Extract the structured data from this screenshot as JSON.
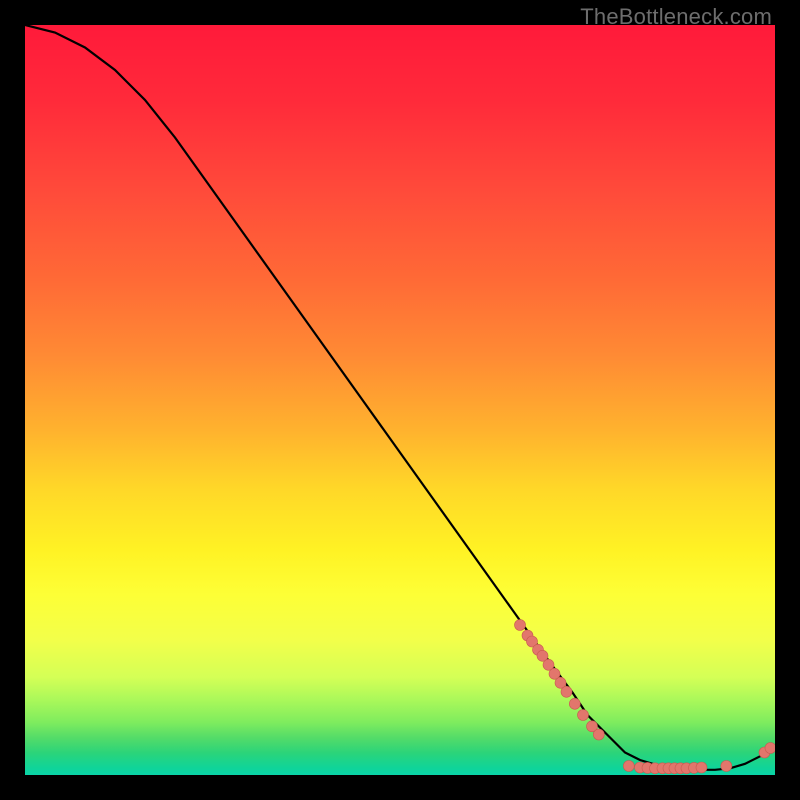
{
  "watermark": "TheBottleneck.com",
  "colors": {
    "curve_stroke": "#000000",
    "dot_fill": "#e2766c",
    "dot_stroke": "#c95a50"
  },
  "chart_data": {
    "type": "line",
    "title": "",
    "xlabel": "",
    "ylabel": "",
    "xlim": [
      0,
      100
    ],
    "ylim": [
      0,
      100
    ],
    "grid": false,
    "legend": false,
    "series": [
      {
        "name": "curve",
        "x": [
          0,
          4,
          8,
          12,
          16,
          20,
          25,
          30,
          35,
          40,
          45,
          50,
          55,
          60,
          65,
          70,
          73,
          75,
          78,
          80,
          82,
          84,
          86,
          88,
          90,
          92,
          94,
          96,
          98,
          100
        ],
        "y": [
          100,
          99,
          97,
          94,
          90,
          85,
          78,
          71,
          64,
          57,
          50,
          43,
          36,
          29,
          22,
          15,
          11,
          8,
          5,
          3,
          2,
          1.4,
          1.0,
          0.8,
          0.7,
          0.7,
          0.9,
          1.5,
          2.5,
          3.8
        ]
      }
    ],
    "points_upper_band": [
      {
        "x": 66,
        "y": 20
      },
      {
        "x": 67,
        "y": 18.6
      },
      {
        "x": 67.6,
        "y": 17.8
      },
      {
        "x": 68.4,
        "y": 16.7
      },
      {
        "x": 69,
        "y": 15.9
      },
      {
        "x": 69.8,
        "y": 14.7
      },
      {
        "x": 70.6,
        "y": 13.5
      },
      {
        "x": 71.4,
        "y": 12.3
      },
      {
        "x": 72.2,
        "y": 11.1
      },
      {
        "x": 73.3,
        "y": 9.5
      },
      {
        "x": 74.4,
        "y": 8.0
      },
      {
        "x": 75.6,
        "y": 6.5
      },
      {
        "x": 76.5,
        "y": 5.4
      }
    ],
    "points_bottom_band": [
      {
        "x": 80.5,
        "y": 1.2
      },
      {
        "x": 82,
        "y": 1.0
      },
      {
        "x": 83,
        "y": 0.95
      },
      {
        "x": 84,
        "y": 0.9
      },
      {
        "x": 85,
        "y": 0.9
      },
      {
        "x": 85.8,
        "y": 0.9
      },
      {
        "x": 86.6,
        "y": 0.9
      },
      {
        "x": 87.4,
        "y": 0.9
      },
      {
        "x": 88.2,
        "y": 0.9
      },
      {
        "x": 89.2,
        "y": 0.95
      },
      {
        "x": 90.2,
        "y": 1.0
      },
      {
        "x": 93.5,
        "y": 1.2
      },
      {
        "x": 98.6,
        "y": 3.0
      },
      {
        "x": 99.4,
        "y": 3.6
      }
    ]
  }
}
